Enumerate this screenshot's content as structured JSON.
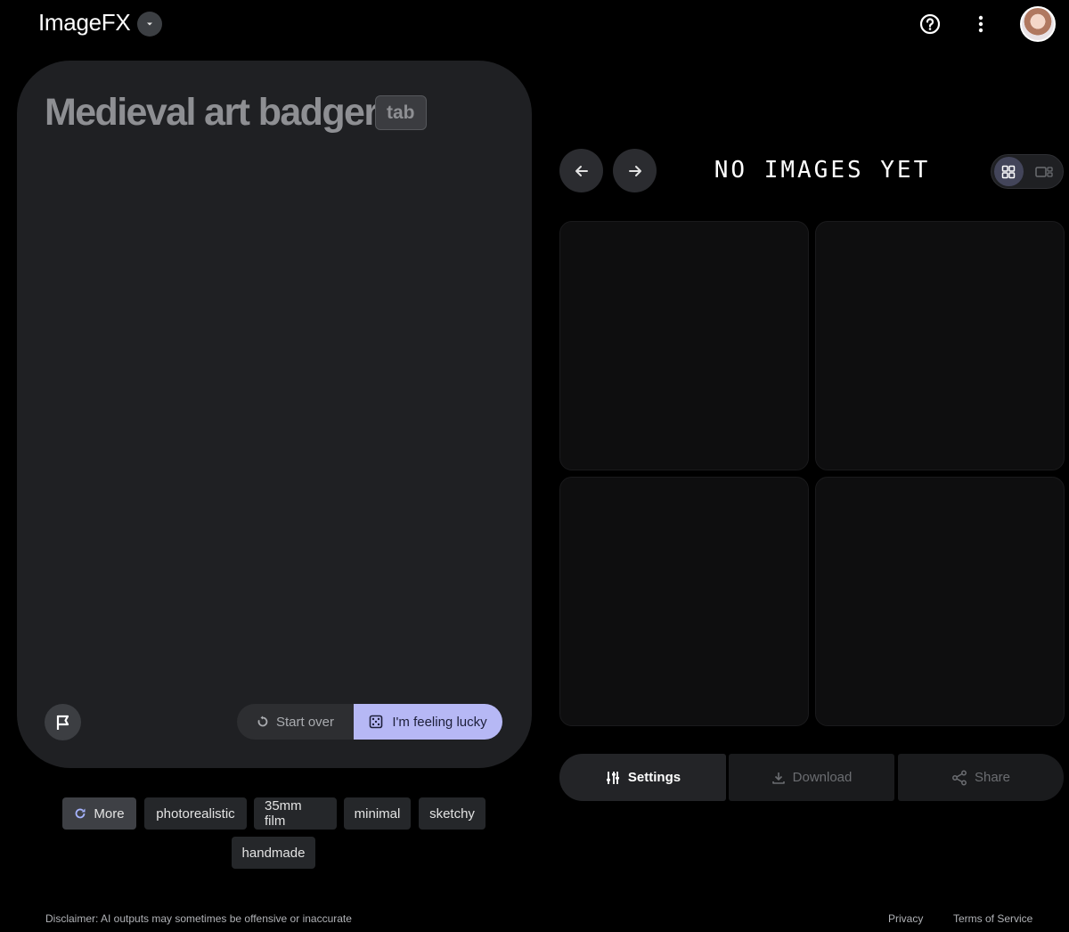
{
  "header": {
    "app_title": "ImageFX",
    "icons": [
      "chevron-down-icon",
      "help-icon",
      "more-vert-icon",
      "avatar"
    ]
  },
  "prompt": {
    "text": "Medieval art badger",
    "tab_hint": "tab"
  },
  "actions": {
    "start_over": "Start over",
    "lucky": "I'm feeling lucky"
  },
  "chips": {
    "more": "More",
    "items": [
      "photorealistic",
      "35mm film",
      "minimal",
      "sketchy",
      "handmade"
    ]
  },
  "gallery": {
    "status": "NO IMAGES YET"
  },
  "buttons": {
    "settings": "Settings",
    "download": "Download",
    "share": "Share"
  },
  "footer": {
    "disclaimer": "Disclaimer: AI outputs may sometimes be offensive or inaccurate",
    "privacy": "Privacy",
    "terms": "Terms of Service"
  },
  "colors": {
    "background": "#000000",
    "card": "#1f2023",
    "accent": "#b6b8f5"
  }
}
